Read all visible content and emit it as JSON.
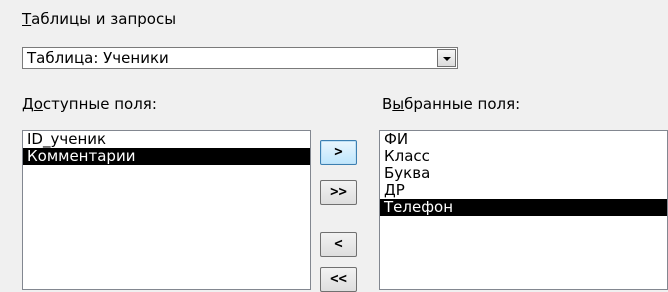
{
  "section_title": {
    "accesskey": "Т",
    "rest": "аблицы и запросы"
  },
  "source_combo": {
    "value": "Таблица: Ученики",
    "dropdown_icon": "chevron-down-icon"
  },
  "available": {
    "label_pre": "Д",
    "label_key": "о",
    "label_rest": "ступные поля:",
    "items": [
      "ID_ученик",
      "Комментарии"
    ],
    "selected_index": 1
  },
  "selected": {
    "label_pre": "В",
    "label_key": "ы",
    "label_rest": "бранные поля:",
    "items": [
      "ФИ",
      "Класс",
      "Буква",
      "ДР",
      "Телефон"
    ],
    "selected_index": 4
  },
  "buttons": {
    "add_one": ">",
    "add_all": ">>",
    "remove_one": "<",
    "remove_all": "<<"
  }
}
